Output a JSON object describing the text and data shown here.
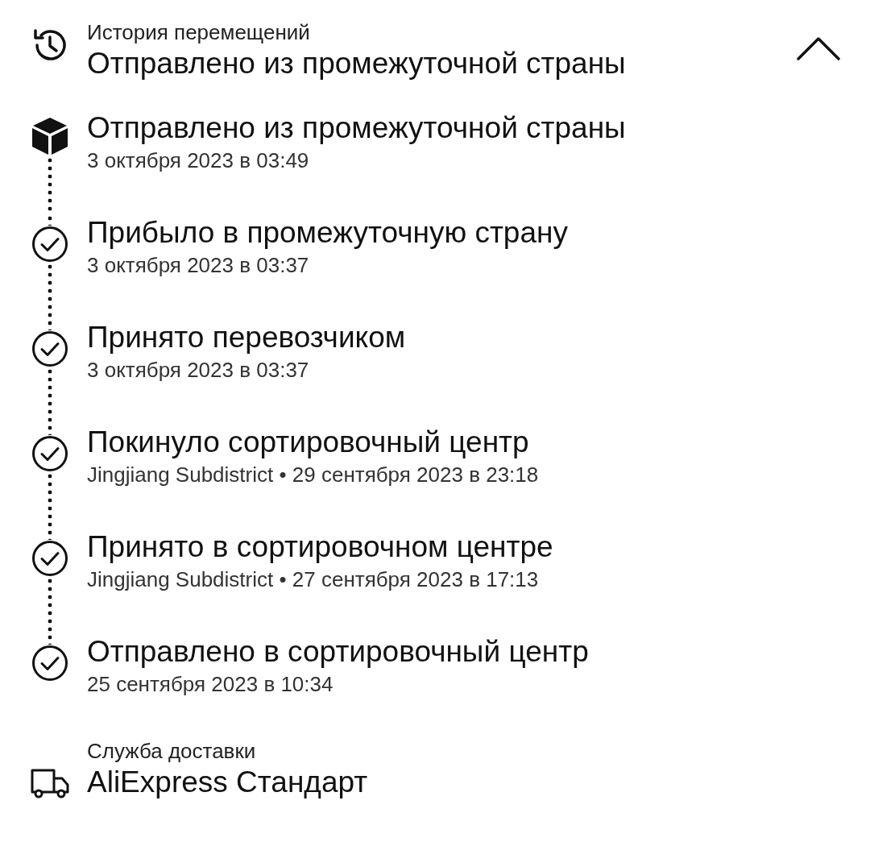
{
  "history": {
    "label": "История перемещений",
    "status": "Отправлено из промежуточной страны",
    "expanded": true
  },
  "events": [
    {
      "kind": "box",
      "title": "Отправлено из промежуточной страны",
      "time": "3 октября 2023 в 03:49"
    },
    {
      "kind": "check",
      "title": "Прибыло в промежуточную страну",
      "time": "3 октября 2023 в 03:37"
    },
    {
      "kind": "check",
      "title": "Принято перевозчиком",
      "time": "3 октября 2023 в 03:37"
    },
    {
      "kind": "check",
      "title": "Покинуло сортировочный центр",
      "time": "Jingjiang Subdistrict • 29 сентября 2023 в 23:18"
    },
    {
      "kind": "check",
      "title": "Принято в сортировочном центре",
      "time": "Jingjiang Subdistrict • 27 сентября 2023 в 17:13"
    },
    {
      "kind": "check",
      "title": "Отправлено в сортировочный центр",
      "time": "25 сентября 2023 в 10:34"
    }
  ],
  "delivery": {
    "label": "Служба доставки",
    "value": "AliExpress Стандарт"
  }
}
